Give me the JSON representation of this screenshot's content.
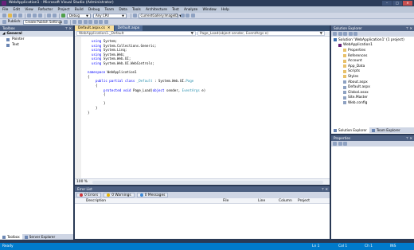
{
  "window": {
    "title": "WebApplication1 - Microsoft Visual Studio (Administrator)"
  },
  "menu": [
    "File",
    "Edit",
    "View",
    "Refactor",
    "Project",
    "Build",
    "Debug",
    "Team",
    "Data",
    "Tools",
    "Architecture",
    "Test",
    "Analyze",
    "Window",
    "Help"
  ],
  "toolbar": {
    "publish_label": "Publish:",
    "publish_profile": "Create Publish Settings",
    "config": "Debug",
    "platform": "Any CPU",
    "find": "CurrentGallery.ImageID"
  },
  "toolbox": {
    "title": "Toolbox",
    "group": "General",
    "items": [
      "Pointer",
      "Text"
    ]
  },
  "left_tabs": [
    "Toolbox",
    "Server Explorer"
  ],
  "editor": {
    "tabs": [
      "Default.aspx.cs",
      "Default.aspx"
    ],
    "nav_class": "WebApplication1._Default",
    "nav_member": "Page_Load(object sender, EventArgs e)",
    "zoom": "100 %",
    "code_lines": [
      {
        "ind": 1,
        "parts": [
          {
            "k": "kw",
            "t": "using"
          },
          {
            "k": "",
            "t": " System;"
          }
        ]
      },
      {
        "ind": 1,
        "parts": [
          {
            "k": "kw",
            "t": "using"
          },
          {
            "k": "",
            "t": " System.Collections.Generic;"
          }
        ]
      },
      {
        "ind": 1,
        "parts": [
          {
            "k": "kw",
            "t": "using"
          },
          {
            "k": "",
            "t": " System.Linq;"
          }
        ]
      },
      {
        "ind": 1,
        "parts": [
          {
            "k": "kw",
            "t": "using"
          },
          {
            "k": "",
            "t": " System.Web;"
          }
        ]
      },
      {
        "ind": 1,
        "parts": [
          {
            "k": "kw",
            "t": "using"
          },
          {
            "k": "",
            "t": " System.Web.UI;"
          }
        ]
      },
      {
        "ind": 1,
        "parts": [
          {
            "k": "kw",
            "t": "using"
          },
          {
            "k": "",
            "t": " System.Web.UI.WebControls;"
          }
        ]
      },
      {
        "ind": 0,
        "parts": []
      },
      {
        "ind": 0,
        "parts": [
          {
            "k": "kw",
            "t": "namespace"
          },
          {
            "k": "",
            "t": " WebApplication1"
          }
        ]
      },
      {
        "ind": 0,
        "parts": [
          {
            "k": "",
            "t": "{"
          }
        ]
      },
      {
        "ind": 2,
        "parts": [
          {
            "k": "kw",
            "t": "public partial class"
          },
          {
            "k": "",
            "t": " "
          },
          {
            "k": "ty",
            "t": "_Default"
          },
          {
            "k": "",
            "t": " : System.Web.UI."
          },
          {
            "k": "ty",
            "t": "Page"
          }
        ]
      },
      {
        "ind": 2,
        "parts": [
          {
            "k": "",
            "t": "{"
          }
        ]
      },
      {
        "ind": 4,
        "parts": [
          {
            "k": "kw",
            "t": "protected void"
          },
          {
            "k": "",
            "t": " Page_Load("
          },
          {
            "k": "kw",
            "t": "object"
          },
          {
            "k": "",
            "t": " sender, "
          },
          {
            "k": "ty",
            "t": "EventArgs"
          },
          {
            "k": "",
            "t": " e)"
          }
        ]
      },
      {
        "ind": 4,
        "parts": [
          {
            "k": "",
            "t": "{"
          }
        ]
      },
      {
        "ind": 0,
        "parts": []
      },
      {
        "ind": 4,
        "parts": [
          {
            "k": "",
            "t": "}"
          }
        ]
      },
      {
        "ind": 2,
        "parts": [
          {
            "k": "",
            "t": "}"
          }
        ]
      },
      {
        "ind": 0,
        "parts": [
          {
            "k": "",
            "t": "}"
          }
        ]
      }
    ]
  },
  "errors": {
    "title": "Error List",
    "filters": {
      "errors": "0 Errors",
      "warnings": "0 Warnings",
      "messages": "0 Messages"
    },
    "columns": [
      "Description",
      "File",
      "Line",
      "Column",
      "Project"
    ]
  },
  "solution": {
    "title": "Solution Explorer",
    "tree": [
      {
        "lvl": 0,
        "ico": "s",
        "text": "Solution 'WebApplication1' (1 project)"
      },
      {
        "lvl": 1,
        "ico": "p",
        "text": "WebApplication1"
      },
      {
        "lvl": 2,
        "ico": "f",
        "text": "Properties"
      },
      {
        "lvl": 2,
        "ico": "f",
        "text": "References"
      },
      {
        "lvl": 2,
        "ico": "f",
        "text": "Account"
      },
      {
        "lvl": 2,
        "ico": "f",
        "text": "App_Data"
      },
      {
        "lvl": 2,
        "ico": "f",
        "text": "Scripts"
      },
      {
        "lvl": 2,
        "ico": "f",
        "text": "Styles"
      },
      {
        "lvl": 2,
        "ico": "",
        "text": "About.aspx"
      },
      {
        "lvl": 2,
        "ico": "",
        "text": "Default.aspx"
      },
      {
        "lvl": 2,
        "ico": "",
        "text": "Global.asax"
      },
      {
        "lvl": 2,
        "ico": "",
        "text": "Site.Master"
      },
      {
        "lvl": 2,
        "ico": "",
        "text": "Web.config"
      }
    ],
    "tabs": [
      "Solution Explorer",
      "Team Explorer"
    ]
  },
  "properties": {
    "title": "Properties"
  },
  "status": {
    "ready": "Ready",
    "ln": "Ln 1",
    "col": "Col 1",
    "ch": "Ch 1",
    "ins": "INS"
  },
  "colors": {
    "chrome": "#293955",
    "status": "#007acc",
    "active_tab": "#f7de9c",
    "keyword": "#0000ff",
    "type": "#2b91af"
  }
}
